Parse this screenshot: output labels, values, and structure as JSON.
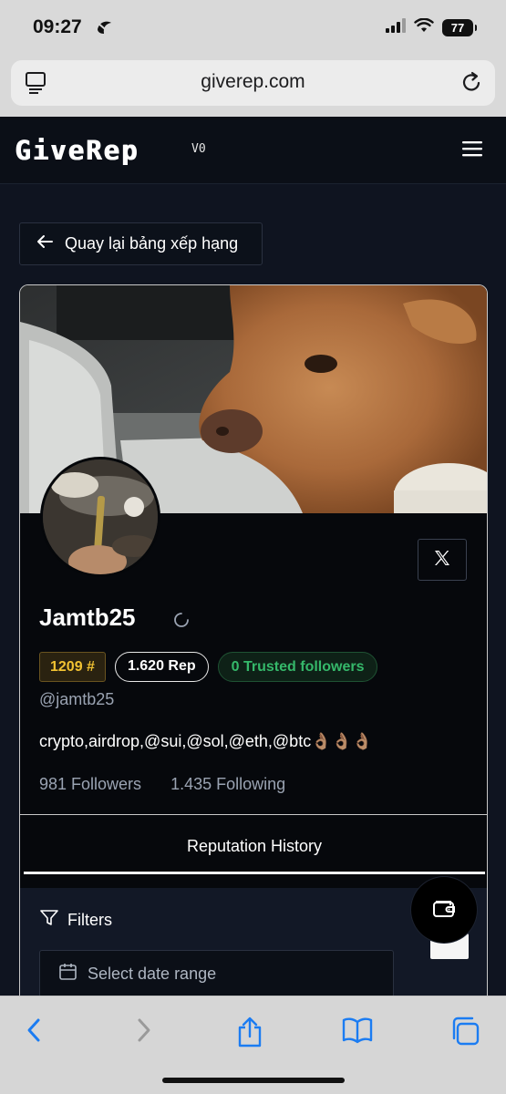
{
  "status_bar": {
    "time": "09:27",
    "battery": "77"
  },
  "browser": {
    "url": "giverep.com"
  },
  "app": {
    "logo": "GiveRep",
    "version": "V0"
  },
  "back_button": {
    "label": "Quay lại bảng xếp hạng"
  },
  "profile": {
    "display_name": "Jamtb25",
    "rank_badge": "1209 #",
    "rep_badge": "1.620 Rep",
    "trusted_badge": "0 Trusted followers",
    "handle": "@jamtb25",
    "bio": "crypto,airdrop,@sui,@sol,@eth,@btc👌🏽👌🏽👌🏽",
    "followers": "981 Followers",
    "following": "1.435 Following"
  },
  "tabs": {
    "reputation_history": "Reputation History"
  },
  "filters": {
    "title": "Filters",
    "date_placeholder": "Select date range"
  },
  "colors": {
    "rank": "#f1c232",
    "trusted": "#35b86a",
    "background": "#0f1420"
  }
}
